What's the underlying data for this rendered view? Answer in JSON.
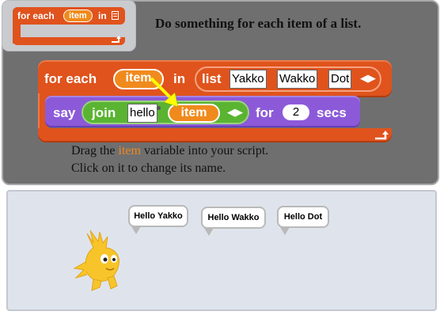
{
  "palette_block": {
    "for_each_label": "for each",
    "variable": "item",
    "in_label": "in",
    "list_icon": "list-icon",
    "loop_arrow_icon": "loop-arrow-icon"
  },
  "caption": "Do something for each item of a list.",
  "script": {
    "for_each_label": "for each",
    "variable": "item",
    "in_label": "in",
    "list_label": "list",
    "list_items": [
      "Yakko",
      "Wakko",
      "Dot"
    ],
    "say_label": "say",
    "join_label": "join",
    "join_text": "hello",
    "join_variable": "item",
    "for_label": "for",
    "secs_value": "2",
    "secs_label": "secs"
  },
  "hint": {
    "line1_before": "Drag the ",
    "line1_var": "item",
    "line1_after": " variable into your script.",
    "line2": "Click on it to change its name."
  },
  "stage": {
    "bubbles": [
      "Hello Yakko",
      "Hello Wakko",
      "Hello Dot"
    ],
    "sprite": "alonzo-sprite"
  },
  "colors": {
    "control_orange": "#e0531d",
    "variable_orange": "#f08a1d",
    "looks_purple": "#8c5ad9",
    "operators_green": "#5ab432",
    "arrow_yellow": "#ffff00"
  }
}
